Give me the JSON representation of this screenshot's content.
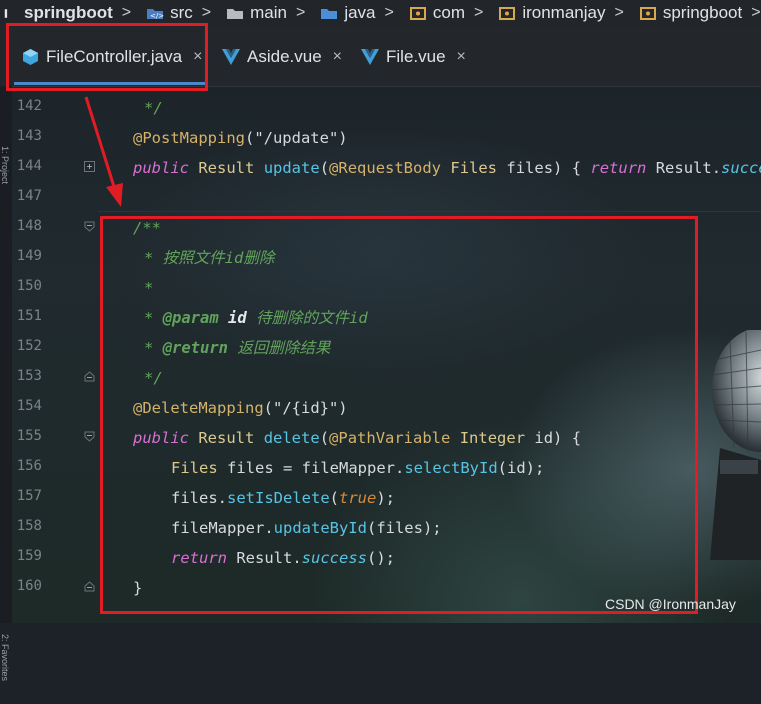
{
  "breadcrumb": [
    {
      "label": "springboot",
      "icon": "project-icon",
      "bold": true
    },
    {
      "label": "src",
      "icon": "source-folder-icon"
    },
    {
      "label": "main",
      "icon": "folder-icon"
    },
    {
      "label": "java",
      "icon": "folder-blue-icon"
    },
    {
      "label": "com",
      "icon": "package-icon"
    },
    {
      "label": "ironmanjay",
      "icon": "package-icon"
    },
    {
      "label": "springboot",
      "icon": "package-icon"
    }
  ],
  "tabs": [
    {
      "label": "FileController.java",
      "icon": "java-class-icon",
      "active": true
    },
    {
      "label": "Aside.vue",
      "icon": "vue-icon",
      "active": false
    },
    {
      "label": "File.vue",
      "icon": "vue-icon",
      "active": false
    }
  ],
  "close_glyph": "×",
  "side_strip": {
    "top": "1: Project",
    "bottom": "2: Favorites"
  },
  "line_numbers": [
    "142",
    "143",
    "144",
    "147",
    "148",
    "149",
    "150",
    "151",
    "152",
    "153",
    "154",
    "155",
    "156",
    "157",
    "158",
    "159",
    "160"
  ],
  "code": {
    "l142": {
      "comment": "*/"
    },
    "l143": {
      "annotation": "@PostMapping",
      "args": "(\"/update\")"
    },
    "l144": {
      "kw_public": "public",
      "type": "Result",
      "name": "update",
      "p1": "(",
      "ann": "@RequestBody",
      "type2": "Files",
      "var": "files",
      "rest": ") { ",
      "kw_return": "return",
      "cls": "Result.",
      "stat": "success"
    },
    "l148": {
      "comment": "/**"
    },
    "l149": {
      "comment": "* 按照文件id删除"
    },
    "l150": {
      "comment": "*"
    },
    "l151": {
      "star": "* ",
      "tag": "@param",
      "pname": "id",
      "desc": "待删除的文件id"
    },
    "l152": {
      "star": "* ",
      "tag": "@return",
      "desc": "返回删除结果"
    },
    "l153": {
      "comment": "*/"
    },
    "l154": {
      "annotation": "@DeleteMapping",
      "args": "(\"/{id}\")"
    },
    "l155": {
      "kw_public": "public",
      "type": "Result",
      "name": "delete",
      "p1": "(",
      "ann": "@PathVariable",
      "type2": "Integer",
      "var": "id",
      "rest": ") {"
    },
    "l156": {
      "type": "Files",
      "var": "files",
      "eq": " = fileMapper.",
      "call": "selectById",
      "args": "(id);"
    },
    "l157": {
      "obj": "files.",
      "call": "setIsDelete",
      "p1": "(",
      "lit": "true",
      "p2": ");"
    },
    "l158": {
      "obj": "fileMapper.",
      "call": "updateById",
      "args": "(files);"
    },
    "l159": {
      "kw_return": "return",
      "cls": "Result.",
      "stat": "success",
      "tail": "();"
    },
    "l160": {
      "brace": "}"
    }
  },
  "watermark": "CSDN @IronmanJay",
  "colors": {
    "highlight_box": "#e01c24",
    "keyword": "#d86fd3",
    "annotation": "#d5b26a",
    "doc_comment": "#62a35b",
    "method": "#57c4e6"
  }
}
